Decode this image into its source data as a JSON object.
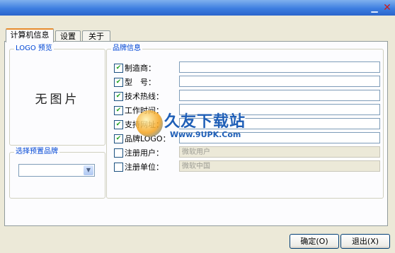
{
  "titlebar": {
    "minimize_glyph": "▁",
    "close_glyph": "✕"
  },
  "tabs": [
    {
      "label": "计算机信息"
    },
    {
      "label": "设置"
    },
    {
      "label": "关于"
    }
  ],
  "logo_group": {
    "title": "LOGO 预览",
    "no_image": "无图片"
  },
  "preset_group": {
    "title": "选择预置品牌",
    "selected": "",
    "arrow": "▼"
  },
  "brand_group": {
    "title": "品牌信息",
    "check_glyph": "✔",
    "rows": [
      {
        "label": "制造商：",
        "checked": true,
        "value": ""
      },
      {
        "label": "型　号：",
        "checked": true,
        "value": ""
      },
      {
        "label": "技术热线：",
        "checked": true,
        "value": ""
      },
      {
        "label": "工作时间：",
        "checked": true,
        "value": ""
      },
      {
        "label": "支持网址：",
        "checked": true,
        "value": ""
      },
      {
        "label": "品牌LOGO：",
        "checked": true,
        "value": ""
      },
      {
        "label": "注册用户：",
        "checked": false,
        "value": "微软用户"
      },
      {
        "label": "注册单位：",
        "checked": false,
        "value": "微软中国"
      }
    ]
  },
  "buttons": {
    "ok": "确定(O)",
    "exit": "退出(X)"
  },
  "watermark": {
    "title": "久友下载站",
    "url": "Www.9UPK.Com"
  }
}
